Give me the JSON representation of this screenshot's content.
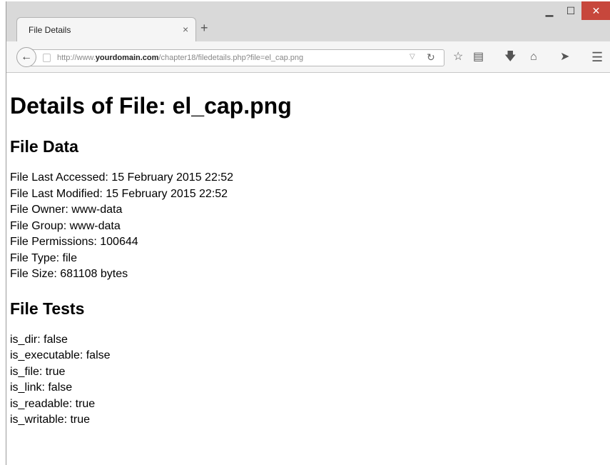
{
  "browser": {
    "tab_title": "File Details",
    "tab_close_icon": "×",
    "new_tab_icon": "+",
    "window_controls": {
      "minimize": "▁",
      "maximize": "☐",
      "close": "✕"
    },
    "url_prefix": "http://www.",
    "url_domain": "yourdomain.com",
    "url_path": "/chapter18/filedetails.php?file=el_cap.png",
    "toolbar_icons": [
      "star-icon",
      "reading-list-icon",
      "download-icon",
      "home-icon",
      "send-icon",
      "menu-icon"
    ]
  },
  "page": {
    "title": "Details of File: el_cap.png",
    "file_data": {
      "heading": "File Data",
      "lines": [
        "File Last Accessed: 15 February 2015 22:52",
        "File Last Modified: 15 February 2015 22:52",
        "File Owner: www-data",
        "File Group: www-data",
        "File Permissions: 100644",
        "File Type: file",
        "File Size: 681108 bytes"
      ]
    },
    "file_tests": {
      "heading": "File Tests",
      "lines": [
        "is_dir: false",
        "is_executable: false",
        "is_file: true",
        "is_link: false",
        "is_readable: true",
        "is_writable: true"
      ]
    }
  }
}
